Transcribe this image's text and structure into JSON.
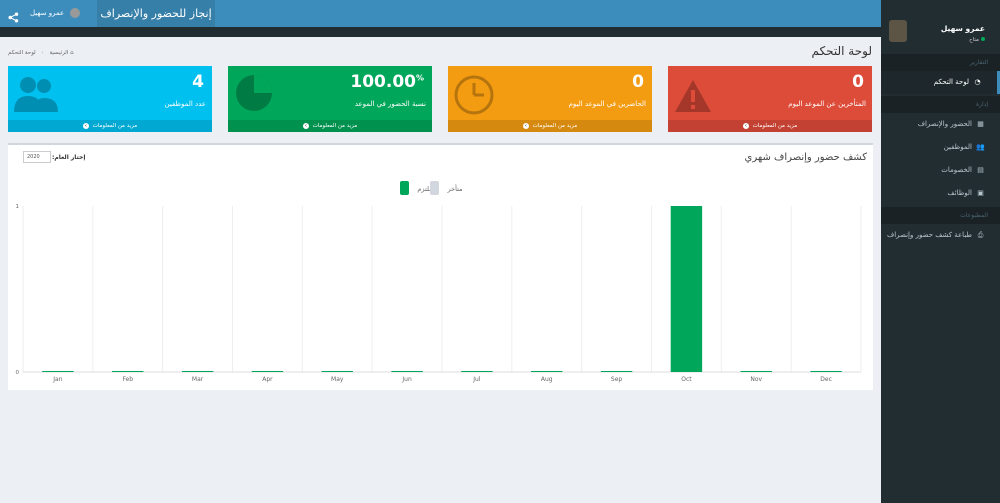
{
  "header": {
    "brand": "إنجاز للحضور والإنصراف",
    "user_name": "عمرو سهيل"
  },
  "sidebar": {
    "user_name": "عمرو سهيل",
    "status": "متاح",
    "sections": [
      {
        "header": "التقارير",
        "items": [
          {
            "label": "لوحة التحكم",
            "icon": "dashboard-icon",
            "active": true
          }
        ]
      },
      {
        "header": "إدارة",
        "items": [
          {
            "label": "الحضور والإنصراف",
            "icon": "calendar-icon",
            "active": false
          },
          {
            "label": "الموظفين",
            "icon": "users-icon",
            "active": false
          },
          {
            "label": "الخصومات",
            "icon": "file-icon",
            "active": false
          },
          {
            "label": "الوظائف",
            "icon": "briefcase-icon",
            "active": false
          }
        ]
      },
      {
        "header": "المطبوعات",
        "items": [
          {
            "label": "طباعة كشف حضور وإنصراف",
            "icon": "print-icon",
            "active": false
          }
        ]
      }
    ]
  },
  "page": {
    "title": "لوحة التحكم",
    "breadcrumb": [
      "الرئيسية",
      "لوحة التحكم"
    ]
  },
  "stats": [
    {
      "value": "0",
      "label": "المتأخرين عن الموعد اليوم",
      "footer": "مزيد من المعلومات",
      "color": "#dd4b39",
      "icon": "warning-icon"
    },
    {
      "value": "0",
      "label": "الحاضرين في الموعد اليوم",
      "footer": "مزيد من المعلومات",
      "color": "#f39c12",
      "icon": "clock-icon"
    },
    {
      "value": "100.00",
      "unit": "%",
      "label": "نسبة الحضور في الموعد",
      "footer": "مزيد من المعلومات",
      "color": "#00a65a",
      "icon": "pie-chart-icon"
    },
    {
      "value": "4",
      "label": "عدد الموظفين",
      "footer": "مزيد من المعلومات",
      "color": "#00c0ef",
      "icon": "users-icon"
    }
  ],
  "chart_panel": {
    "title": "كشف حضور وإنصراف شهري",
    "year_label": "إختار العام:",
    "year_value": "2020"
  },
  "chart_data": {
    "type": "bar",
    "categories": [
      "Jan",
      "Feb",
      "Mar",
      "Apr",
      "May",
      "Jun",
      "Jul",
      "Aug",
      "Sep",
      "Oct",
      "Nov",
      "Dec"
    ],
    "series": [
      {
        "name": "ملتزم",
        "color": "#00a65a",
        "values": [
          0,
          0,
          0,
          0,
          0,
          0,
          0,
          0,
          0,
          1,
          0,
          0
        ]
      },
      {
        "name": "متأخر",
        "color": "#d2d6de",
        "values": [
          0,
          0,
          0,
          0,
          0,
          0,
          0,
          0,
          0,
          0,
          0,
          0
        ]
      }
    ],
    "ylim": [
      0,
      1
    ],
    "yticks": [
      "0",
      "1"
    ],
    "legend": "top-center",
    "grid": true
  }
}
